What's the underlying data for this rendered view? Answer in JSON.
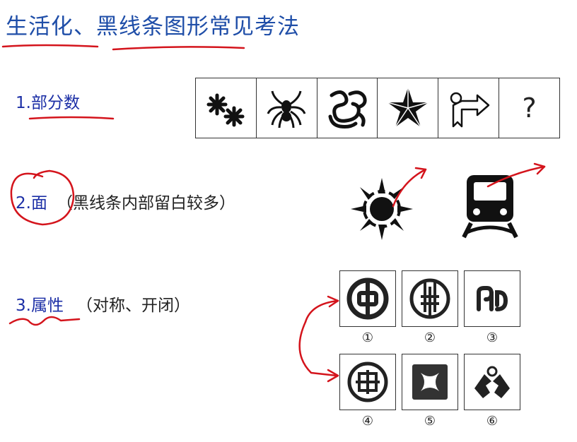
{
  "title": "生活化、黑线条图形常见考法",
  "sections": [
    {
      "label": "1.部分数",
      "note": ""
    },
    {
      "label": "2.面",
      "note": "（黑线条内部留白较多）"
    },
    {
      "label": "3.属性",
      "note": "（对称、开闭）"
    }
  ],
  "strip_cells": [
    {
      "icon": "snowflake-pair-icon"
    },
    {
      "icon": "spider-icon"
    },
    {
      "icon": "swirl-ornament-icon"
    },
    {
      "icon": "star-icon"
    },
    {
      "icon": "arrow-sign-icon"
    },
    {
      "icon": "question-mark",
      "text": "?"
    }
  ],
  "section2_icons": [
    "sun-icon",
    "train-icon"
  ],
  "logo_grid": [
    {
      "number": "①",
      "icon": "bank-of-china-logo-icon"
    },
    {
      "number": "②",
      "icon": "agricultural-bank-logo-icon"
    },
    {
      "number": "③",
      "icon": "spd-bank-logo-icon"
    },
    {
      "number": "④",
      "icon": "icbc-logo-icon"
    },
    {
      "number": "⑤",
      "icon": "square-star-logo-icon"
    },
    {
      "number": "⑥",
      "icon": "hands-logo-icon"
    }
  ],
  "colors": {
    "title": "#1f4ea8",
    "label": "#1c2fa6",
    "annotation": "#d4141c"
  }
}
